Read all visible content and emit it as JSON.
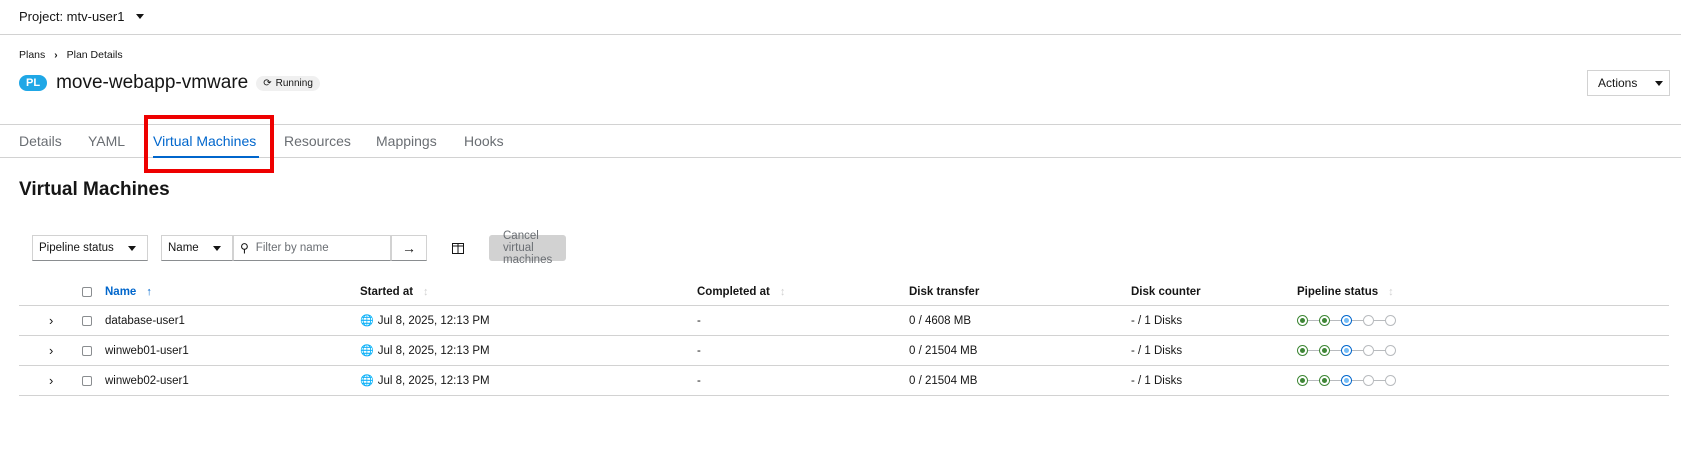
{
  "project": {
    "label": "Project: mtv-user1"
  },
  "breadcrumb": {
    "items": [
      "Plans",
      "Plan Details"
    ]
  },
  "plan": {
    "badge": "PL",
    "title": "move-webapp-vmware",
    "status": "Running"
  },
  "actions": {
    "label": "Actions"
  },
  "tabs": [
    {
      "label": "Details"
    },
    {
      "label": "YAML"
    },
    {
      "label": "Virtual Machines",
      "active": true
    },
    {
      "label": "Resources"
    },
    {
      "label": "Mappings"
    },
    {
      "label": "Hooks"
    }
  ],
  "section": {
    "title": "Virtual Machines"
  },
  "toolbar": {
    "filter_type": "Pipeline status",
    "attribute": "Name",
    "search_placeholder": "Filter by name",
    "cancel_label": "Cancel virtual machines"
  },
  "table": {
    "columns": [
      "Name",
      "Started at",
      "Completed at",
      "Disk transfer",
      "Disk counter",
      "Pipeline status"
    ],
    "rows": [
      {
        "name": "database-user1",
        "started": "Jul 8, 2025, 12:13 PM",
        "completed": "-",
        "disk_transfer": "0 / 4608 MB",
        "disk_counter": "- / 1 Disks",
        "pipeline": [
          "done",
          "done",
          "running",
          "pending",
          "pending"
        ]
      },
      {
        "name": "winweb01-user1",
        "started": "Jul 8, 2025, 12:13 PM",
        "completed": "-",
        "disk_transfer": "0 / 21504 MB",
        "disk_counter": "- / 1 Disks",
        "pipeline": [
          "done",
          "done",
          "running",
          "pending",
          "pending"
        ]
      },
      {
        "name": "winweb02-user1",
        "started": "Jul 8, 2025, 12:13 PM",
        "completed": "-",
        "disk_transfer": "0 / 21504 MB",
        "disk_counter": "- / 1 Disks",
        "pipeline": [
          "done",
          "done",
          "running",
          "pending",
          "pending"
        ]
      }
    ]
  },
  "colors": {
    "accent": "#0066cc",
    "badge": "#1fa7e6",
    "highlight": "#ee0000",
    "success": "#3e8635"
  }
}
